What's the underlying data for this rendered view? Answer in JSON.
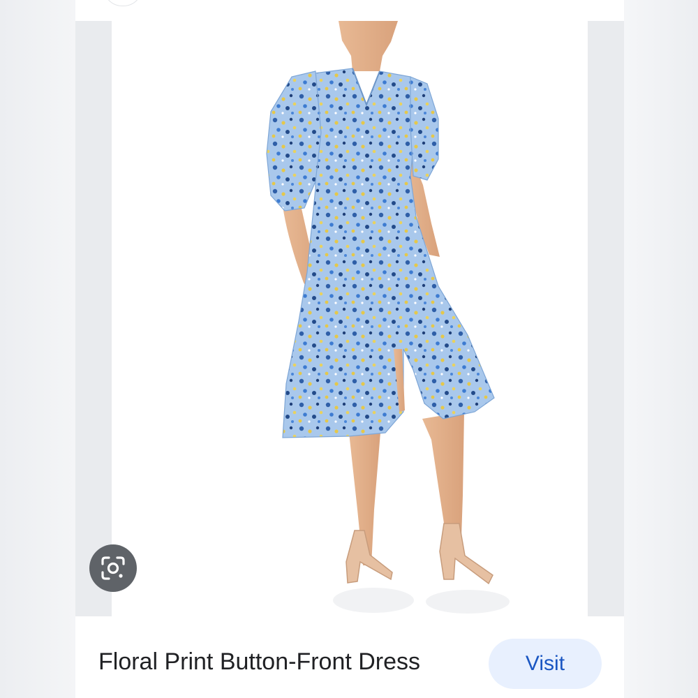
{
  "result": {
    "title": "Floral Print Button-Front Dress",
    "visit_label": "Visit",
    "image_alt": "floral print dress product photo"
  },
  "icons": {
    "lens": "google-lens-icon"
  },
  "colors": {
    "lens_button_bg": "#5f6368",
    "visit_button_bg": "#e8f0fe",
    "visit_text": "#1a56c2",
    "dress_base": "#a9c8ec"
  }
}
